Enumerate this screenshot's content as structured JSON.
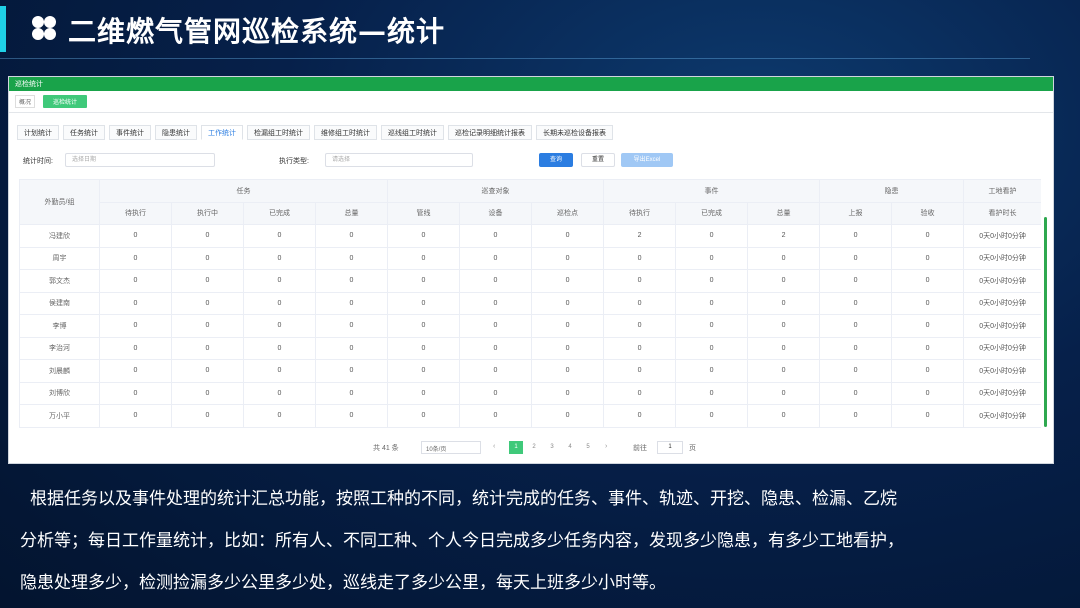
{
  "header": {
    "title": "二维燃气管网巡检系统—统计",
    "icon": "four-dots-icon"
  },
  "window": {
    "title": "巡检统计"
  },
  "breadcrumb": {
    "home": "概况",
    "active": "巡检统计"
  },
  "tabs": [
    {
      "label": "计划统计",
      "active": false
    },
    {
      "label": "任务统计",
      "active": false
    },
    {
      "label": "事件统计",
      "active": false
    },
    {
      "label": "隐患统计",
      "active": false
    },
    {
      "label": "工作统计",
      "active": true
    },
    {
      "label": "检漏组工时统计",
      "active": false
    },
    {
      "label": "维修组工时统计",
      "active": false
    },
    {
      "label": "巡线组工时统计",
      "active": false
    },
    {
      "label": "巡检记录明细统计报表",
      "active": false
    },
    {
      "label": "长期未巡检设备报表",
      "active": false
    }
  ],
  "filters": {
    "time_label": "统计时间:",
    "time_placeholder": "选择日期",
    "type_label": "执行类型:",
    "type_placeholder": "请选择",
    "query": "查询",
    "reset": "重置",
    "export": "导出Excel"
  },
  "table": {
    "row_header": "外勤员/组",
    "groups": [
      {
        "label": "任务",
        "span": 4
      },
      {
        "label": "巡查对象",
        "span": 3
      },
      {
        "label": "事件",
        "span": 3
      },
      {
        "label": "隐患",
        "span": 2
      },
      {
        "label": "工地看护",
        "span": 1
      }
    ],
    "columns": [
      "待执行",
      "执行中",
      "已完成",
      "总量",
      "管线",
      "设备",
      "巡检点",
      "待执行",
      "已完成",
      "总量",
      "上报",
      "验收",
      "看护时长"
    ],
    "rows": [
      {
        "name": "冯建欣",
        "values": [
          "0",
          "0",
          "0",
          "0",
          "0",
          "0",
          "0",
          "2",
          "0",
          "2",
          "0",
          "0",
          "0天0小时0分钟"
        ]
      },
      {
        "name": "周宇",
        "values": [
          "0",
          "0",
          "0",
          "0",
          "0",
          "0",
          "0",
          "0",
          "0",
          "0",
          "0",
          "0",
          "0天0小时0分钟"
        ]
      },
      {
        "name": "郭文杰",
        "values": [
          "0",
          "0",
          "0",
          "0",
          "0",
          "0",
          "0",
          "0",
          "0",
          "0",
          "0",
          "0",
          "0天0小时0分钟"
        ]
      },
      {
        "name": "侯建南",
        "values": [
          "0",
          "0",
          "0",
          "0",
          "0",
          "0",
          "0",
          "0",
          "0",
          "0",
          "0",
          "0",
          "0天0小时0分钟"
        ]
      },
      {
        "name": "李博",
        "values": [
          "0",
          "0",
          "0",
          "0",
          "0",
          "0",
          "0",
          "0",
          "0",
          "0",
          "0",
          "0",
          "0天0小时0分钟"
        ]
      },
      {
        "name": "李治河",
        "values": [
          "0",
          "0",
          "0",
          "0",
          "0",
          "0",
          "0",
          "0",
          "0",
          "0",
          "0",
          "0",
          "0天0小时0分钟"
        ]
      },
      {
        "name": "刘晨麟",
        "values": [
          "0",
          "0",
          "0",
          "0",
          "0",
          "0",
          "0",
          "0",
          "0",
          "0",
          "0",
          "0",
          "0天0小时0分钟"
        ]
      },
      {
        "name": "刘博欣",
        "values": [
          "0",
          "0",
          "0",
          "0",
          "0",
          "0",
          "0",
          "0",
          "0",
          "0",
          "0",
          "0",
          "0天0小时0分钟"
        ]
      },
      {
        "name": "万小平",
        "values": [
          "0",
          "0",
          "0",
          "0",
          "0",
          "0",
          "0",
          "0",
          "0",
          "0",
          "0",
          "0",
          "0天0小时0分钟"
        ]
      }
    ]
  },
  "pagination": {
    "total": "共 41 条",
    "page_size": "10条/页",
    "pages": [
      "1",
      "2",
      "3",
      "4",
      "5"
    ],
    "current": "1",
    "goto_label": "前往",
    "goto_value": "1",
    "page_unit": "页"
  },
  "caption": {
    "line1": "根据任务以及事件处理的统计汇总功能，按照工种的不同，统计完成的任务、事件、轨迹、开挖、隐患、检漏、乙烷",
    "line2": "分析等；每日工作量统计，比如：所有人、不同工种、个人今日完成多少任务内容，发现多少隐患，有多少工地看护，",
    "line3": "隐患处理多少，检测捡漏多少公里多少处，巡线走了多少公里，每天上班多少小时等。"
  }
}
